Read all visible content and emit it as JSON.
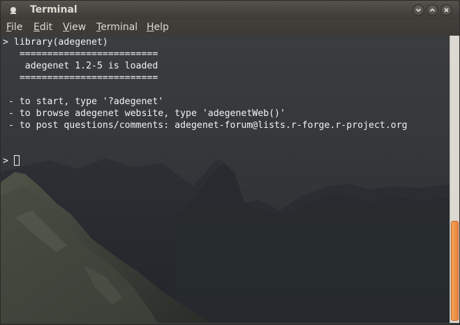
{
  "window": {
    "title": "Terminal",
    "controls": {
      "minimize_icon": "minimize-icon",
      "maximize_icon": "maximize-icon",
      "close_icon": "close-icon"
    }
  },
  "menubar": {
    "items": [
      {
        "mnemonic": "F",
        "rest": "ile"
      },
      {
        "mnemonic": "E",
        "rest": "dit"
      },
      {
        "mnemonic": "V",
        "rest": "iew"
      },
      {
        "mnemonic": "T",
        "rest": "erminal"
      },
      {
        "mnemonic": "H",
        "rest": "elp"
      }
    ]
  },
  "terminal": {
    "lines": [
      "> library(adegenet)",
      "   =========================",
      "    adegenet 1.2-5 is loaded",
      "   =========================",
      "",
      " - to start, type '?adegenet'",
      " - to browse adegenet website, type 'adegenetWeb()'",
      " - to post questions/comments: adegenet-forum@lists.r-forge.r-project.org",
      "",
      ""
    ],
    "prompt": "> "
  },
  "colors": {
    "title_text": "#dfdbd2",
    "terminal_text": "#f2f2f2",
    "scroll_thumb": "#ee9549"
  }
}
